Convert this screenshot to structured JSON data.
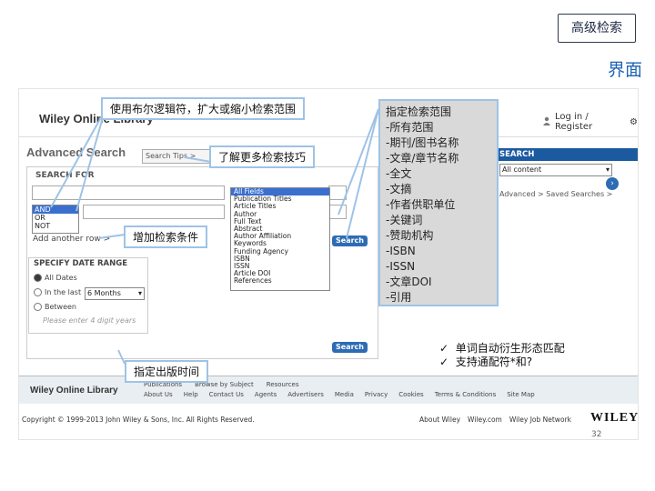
{
  "header": {
    "title": "高级检索",
    "subtitle": "界面"
  },
  "site": {
    "logo": "Wiley Online Library",
    "login": "Log in / Register",
    "advanced_title": "Advanced Search",
    "search_tips": "Search Tips >",
    "search_for_label": "SEARCH FOR",
    "boolean_options": [
      "AND",
      "OR",
      "NOT"
    ],
    "add_row": "Add another row >",
    "scope_options": [
      "All Fields",
      "Publication Titles",
      "Article Titles",
      "Author",
      "Full Text",
      "Abstract",
      "Author Affiliation",
      "Keywords",
      "Funding Agency",
      "ISBN",
      "ISSN",
      "Article DOI",
      "References"
    ],
    "search_button": "Search",
    "date_range_label": "SPECIFY DATE RANGE",
    "date_options": {
      "all_dates": "All Dates",
      "in_last": "In the last",
      "between": "Between"
    },
    "months_value": "6 Months",
    "date_placeholder": "Please enter 4 digit years",
    "right_search_head": "SEARCH",
    "right_select_value": "All content",
    "advanced_links": "Advanced >   Saved Searches >",
    "footer_logo": "Wiley Online Library",
    "footer_links_row1": [
      "Publications",
      "Browse by Subject",
      "Resources"
    ],
    "footer_links_row2": [
      "About Us",
      "Help",
      "Contact Us",
      "Agents",
      "Advertisers",
      "Media",
      "Privacy",
      "Cookies",
      "Terms & Conditions",
      "Site Map"
    ],
    "copyright": "Copyright © 1999-2013 John Wiley & Sons, Inc. All Rights Reserved.",
    "bottom_links": [
      "About Wiley",
      "Wiley.com",
      "Wiley Job Network"
    ],
    "wiley_mark": "WILEY"
  },
  "callouts": {
    "boolean": "使用布尔逻辑符，扩大或缩小检索范围",
    "tips": "了解更多检索技巧",
    "add_condition": "增加检索条件",
    "date": "指定出版时间",
    "scope_lines": [
      "指定检索范围",
      "-所有范围",
      "-期刊/图书名称",
      "-文章/章节名称",
      "-全文",
      "-文摘",
      "-作者供职单位",
      "-关键词",
      "-赞助机构",
      "-ISBN",
      "-ISSN",
      "-文章DOI",
      "-引用"
    ],
    "checks": [
      "单词自动衍生形态匹配",
      "支持通配符*和?"
    ]
  },
  "page_number": "32"
}
